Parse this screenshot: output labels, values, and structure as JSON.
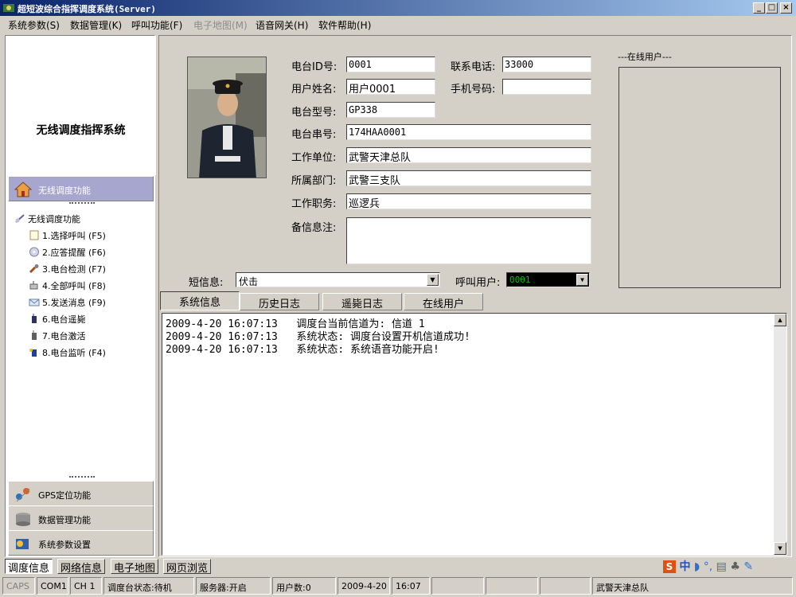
{
  "window": {
    "title": "超短波综合指挥调度系统(Server)",
    "minimize": "_",
    "maximize": "□",
    "close": "×"
  },
  "menu": [
    {
      "label": "系统参数(S)",
      "enabled": true
    },
    {
      "label": "数据管理(K)",
      "enabled": true
    },
    {
      "label": "呼叫功能(F)",
      "enabled": true
    },
    {
      "label": "电子地图(M)",
      "enabled": false
    },
    {
      "label": "语音网关(H)",
      "enabled": true
    },
    {
      "label": "软件帮助(H)",
      "enabled": true
    }
  ],
  "sidebar": {
    "brand_title": "无线调度指挥系统",
    "active_section": "无线调度功能",
    "tree_root": "无线调度功能",
    "items": [
      {
        "label": "1.选择呼叫 (F5)",
        "icon": "page-icon"
      },
      {
        "label": "2.应答提醒 (F6)",
        "icon": "cd-icon"
      },
      {
        "label": "3.电台检测 (F7)",
        "icon": "tool-icon"
      },
      {
        "label": "4.全部呼叫 (F8)",
        "icon": "broadcast-icon"
      },
      {
        "label": "5.发送消息 (F9)",
        "icon": "message-icon"
      },
      {
        "label": "6.电台遥毙",
        "icon": "radio-kill-icon"
      },
      {
        "label": "7.电台激活",
        "icon": "radio-activate-icon"
      },
      {
        "label": "8.电台监听 (F4)",
        "icon": "monitor-icon"
      }
    ],
    "sections": [
      {
        "label": "GPS定位功能",
        "icon": "gps-icon"
      },
      {
        "label": "数据管理功能",
        "icon": "database-icon"
      },
      {
        "label": "系统参数设置",
        "icon": "settings-icon"
      }
    ]
  },
  "form": {
    "radio_id_label": "电台ID号:",
    "radio_id": "0001",
    "phone_label": "联系电话:",
    "phone": "33000",
    "user_name_label": "用户姓名:",
    "user_name": "用户0001",
    "mobile_label": "手机号码:",
    "mobile": "",
    "model_label": "电台型号:",
    "model": "GP338",
    "serial_label": "电台串号:",
    "serial": "174HAA0001",
    "unit_label": "工作单位:",
    "unit": "武警天津总队",
    "dept_label": "所属部门:",
    "dept": "武警三支队",
    "duty_label": "工作职务:",
    "duty": "巡逻兵",
    "note_label": "备信息注:",
    "note": ""
  },
  "online_users_title": "---在线用户---",
  "sms": {
    "label": "短信息:",
    "value": "伏击"
  },
  "call_user": {
    "label": "呼叫用户:",
    "value": "0001"
  },
  "tabs": [
    "系统信息",
    "历史日志",
    "遥毙日志",
    "在线用户"
  ],
  "log": [
    {
      "time": "2009-4-20 16:07:13",
      "text": "调度台当前信道为: 信道 1"
    },
    {
      "time": "2009-4-20 16:07:13",
      "text": "系统状态: 调度台设置开机信道成功!"
    },
    {
      "time": "2009-4-20 16:07:13",
      "text": "系统状态: 系统语音功能开启!"
    }
  ],
  "bottom_tabs": [
    "调度信息",
    "网络信息",
    "电子地图",
    "网页浏览"
  ],
  "tray": {
    "ime": "S",
    "lang": "中"
  },
  "status": {
    "caps": "CAPS",
    "com": "COM1",
    "channel": "CH 1",
    "console_state": "调度台状态:待机",
    "server": "服务器:开启",
    "user_count": "用户数:0",
    "date": "2009-4-20",
    "time": "16:07",
    "org": "武警天津总队"
  },
  "colors": {
    "titlebar_start": "#0a246a",
    "titlebar_end": "#a6caf0",
    "active_section": "#a6a6cf",
    "face": "#d4d0c8"
  }
}
